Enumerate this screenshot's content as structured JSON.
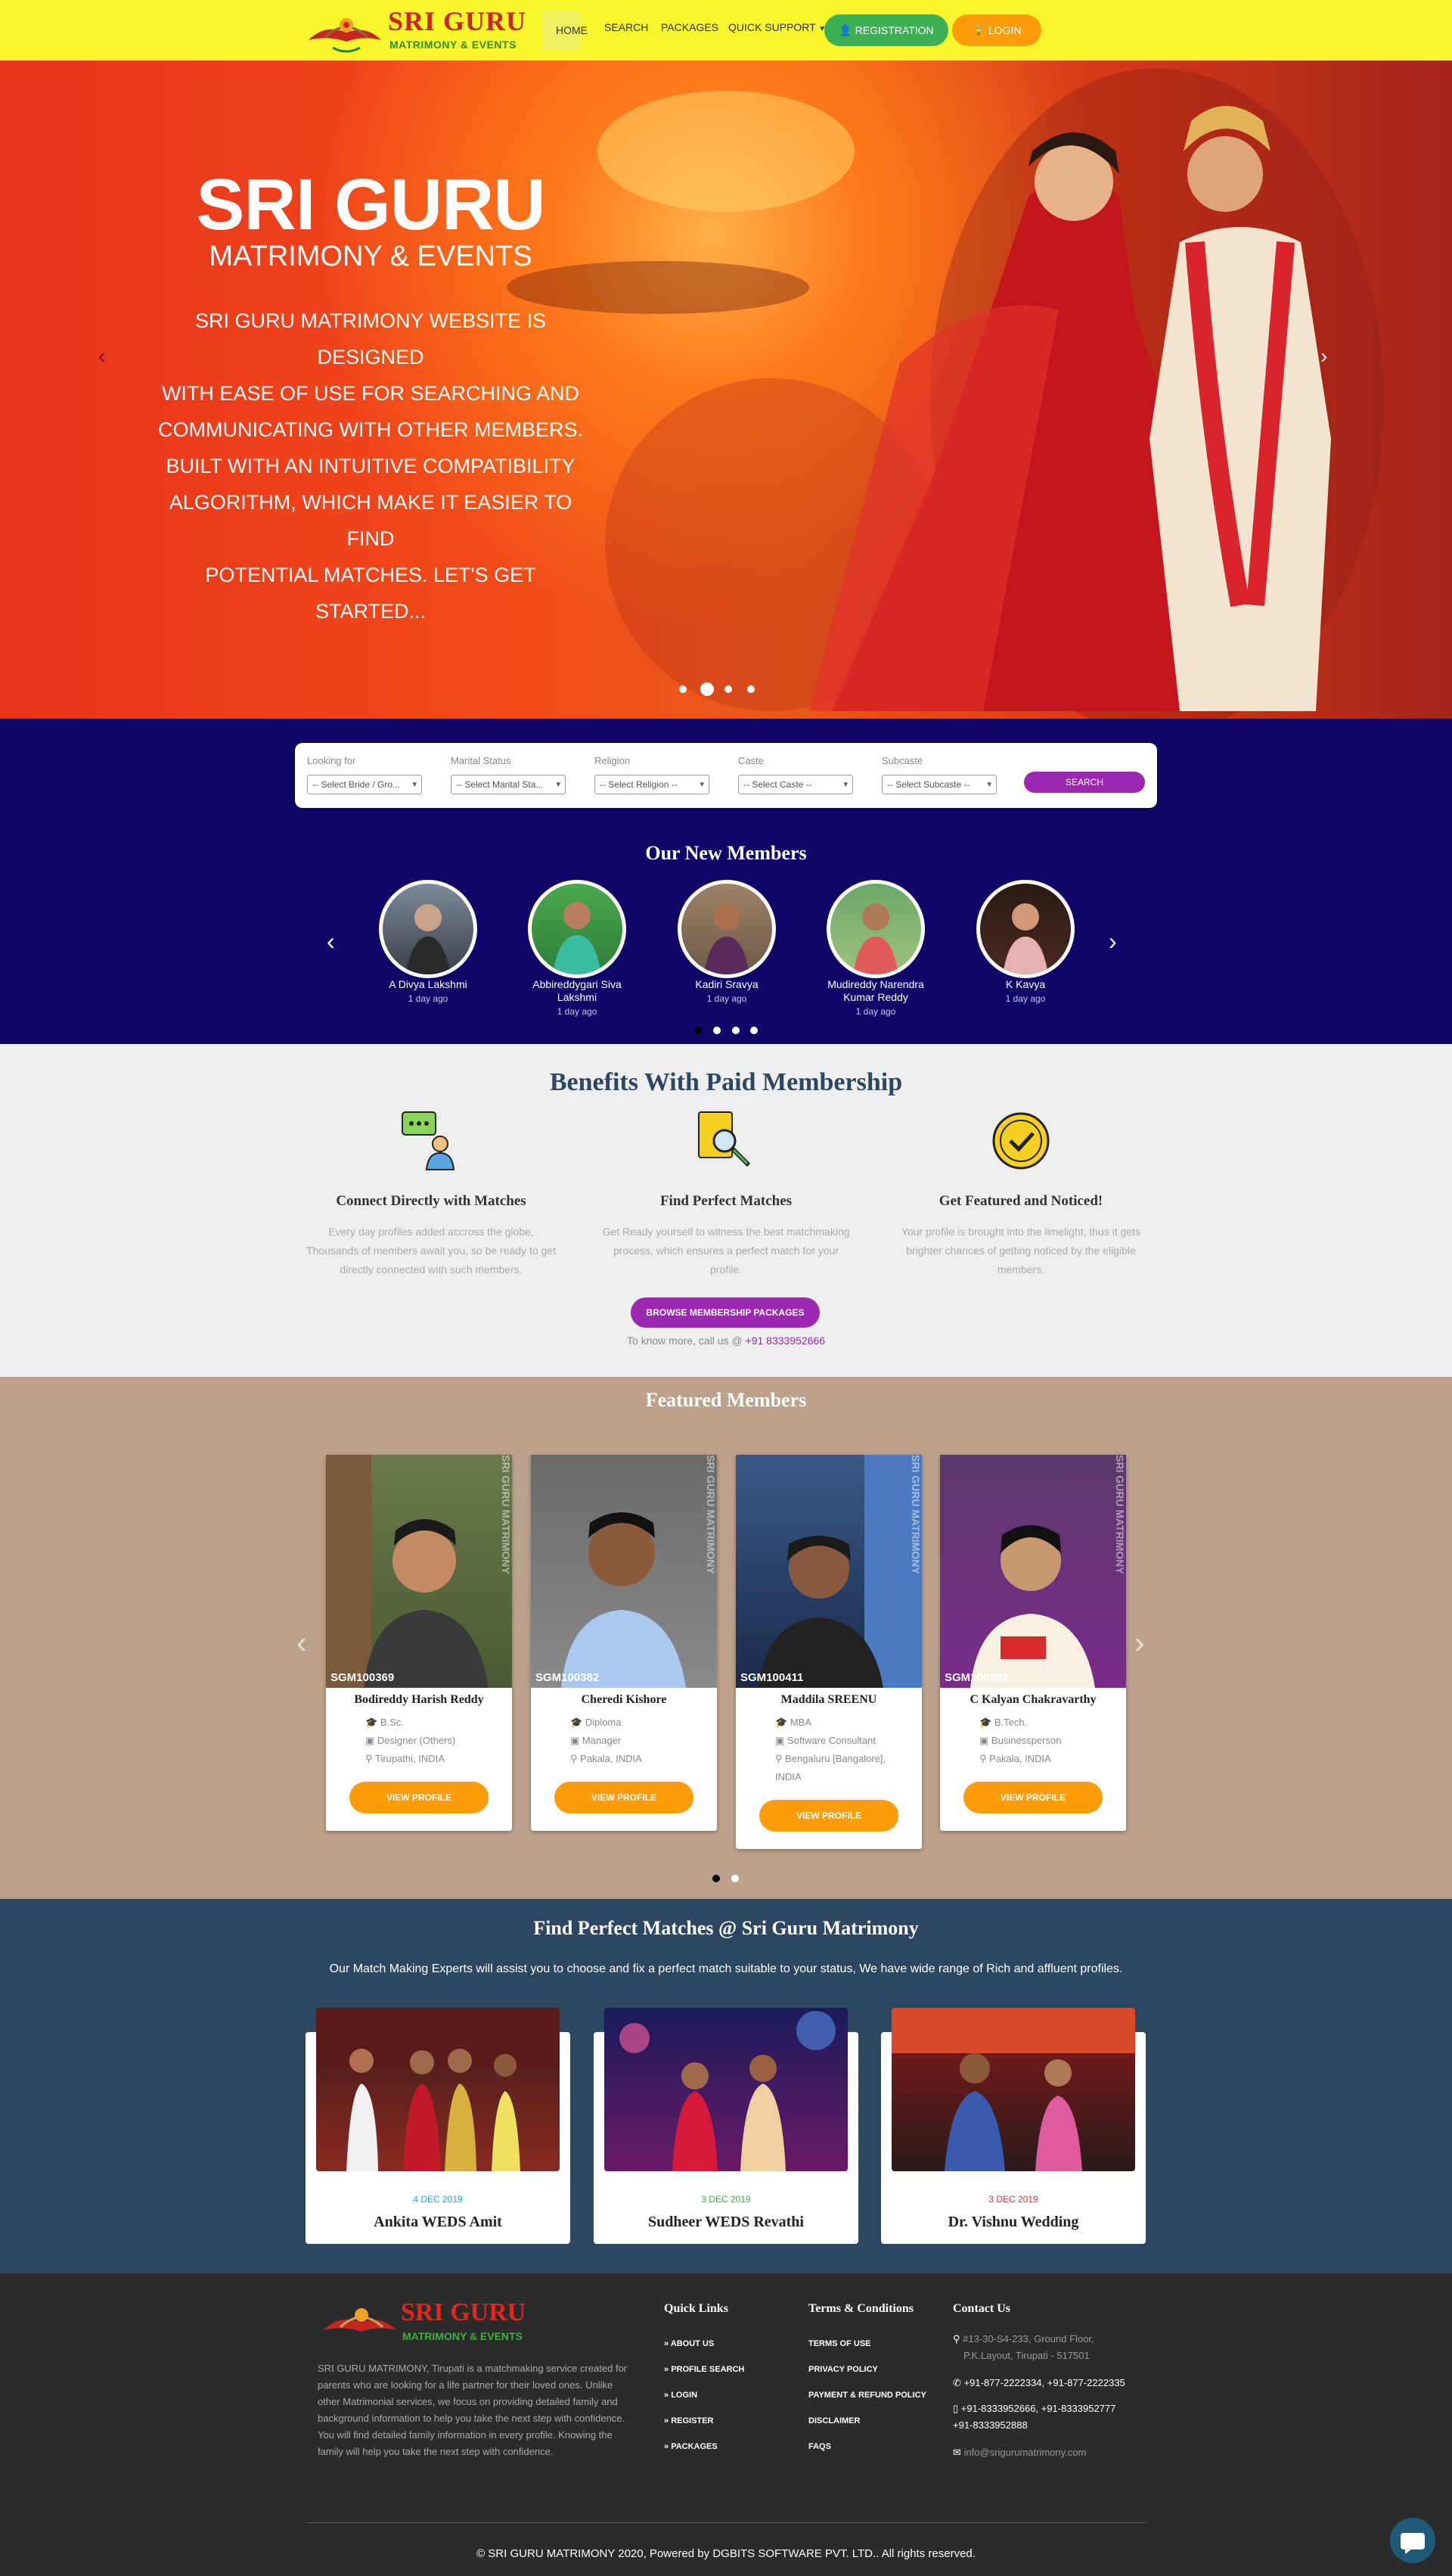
{
  "header": {
    "logo_main": "SRI GURU",
    "logo_sub": "MATRIMONY & EVENTS",
    "nav": [
      "HOME",
      "SEARCH",
      "PACKAGES",
      "QUICK SUPPORT"
    ],
    "registration": "REGISTRATION",
    "login": "LOGIN"
  },
  "hero": {
    "title": "SRI GURU",
    "subtitle": "MATRIMONY & EVENTS",
    "lines": [
      "SRI GURU MATRIMONY WEBSITE IS DESIGNED",
      "WITH EASE OF USE FOR SEARCHING AND",
      "COMMUNICATING WITH OTHER MEMBERS.",
      "BUILT WITH AN INTUITIVE COMPATIBILITY",
      "ALGORITHM, WHICH MAKE IT EASIER TO FIND",
      "POTENTIAL MATCHES.  LET'S GET STARTED..."
    ]
  },
  "search": {
    "fields": [
      {
        "label": "Looking for",
        "value": "-- Select Bride / Gro..."
      },
      {
        "label": "Marital Status",
        "value": "-- Select Marital Sta..."
      },
      {
        "label": "Religion",
        "value": "-- Select Religion --"
      },
      {
        "label": "Caste",
        "value": "-- Select Caste --"
      },
      {
        "label": "Subcaste",
        "value": "-- Select Subcaste --"
      }
    ],
    "button": "SEARCH"
  },
  "new_members": {
    "title": "Our New Members",
    "members": [
      {
        "name": "A Divya Lakshmi",
        "time": "1 day ago"
      },
      {
        "name": "Abbireddygari Siva Lakshmi",
        "time": "1 day ago"
      },
      {
        "name": "Kadiri Sravya",
        "time": "1 day ago"
      },
      {
        "name": "Mudireddy Narendra Kumar Reddy",
        "time": "1 day ago"
      },
      {
        "name": "K Kavya",
        "time": "1 day ago"
      }
    ]
  },
  "benefits": {
    "title": "Benefits With Paid Membership",
    "items": [
      {
        "title": "Connect Directly with Matches",
        "text": "Every day profiles added accross the globe, Thousands of members await you, so be ready to get directly connected with such members."
      },
      {
        "title": "Find Perfect Matches",
        "text": "Get Ready yourself to witness the best matchmaking process, which ensures a perfect match for your profile."
      },
      {
        "title": "Get Featured and Noticed!",
        "text": "Your profile is brought into the limelight, thus it gets brighter chances of getting noticed by the eligible members."
      }
    ],
    "button": "BROWSE MEMBERSHIP PACKAGES",
    "call_text": "To know more, call us @",
    "phone": "+91 8333952666"
  },
  "featured": {
    "title": "Featured Members",
    "watermark": "SRI GURU MATRIMONY",
    "view": "VIEW PROFILE",
    "cards": [
      {
        "id": "SGM100369",
        "name": "Bodireddy Harish Reddy",
        "edu": "B.Sc.",
        "job": "Designer (Others)",
        "loc": "Tirupathi, INDIA"
      },
      {
        "id": "SGM100382",
        "name": "Cheredi Kishore",
        "edu": "Diploma",
        "job": "Manager",
        "loc": "Pakala, INDIA"
      },
      {
        "id": "SGM100411",
        "name": "Maddila SREENU",
        "edu": "MBA",
        "job": "Software Consultant",
        "loc": "Bengaluru [Bangalore], INDIA"
      },
      {
        "id": "SGM100392",
        "name": "C Kalyan Chakravarthy",
        "edu": "B.Tech.",
        "job": "Businessperson",
        "loc": "Pakala, INDIA"
      }
    ]
  },
  "weddings": {
    "title": "Find Perfect Matches @ Sri Guru Matrimony",
    "subtitle": "Our Match Making Experts will assist you to choose and fix a perfect match suitable to your status, We have wide range of Rich and affluent profiles.",
    "items": [
      {
        "date": "4 DEC 2019",
        "title": "Ankita WEDS Amit",
        "color": "#2a9fd8"
      },
      {
        "date": "3 DEC 2019",
        "title": "Sudheer WEDS Revathi",
        "color": "#3aa64a"
      },
      {
        "date": "3 DEC 2019",
        "title": "Dr. Vishnu Wedding",
        "color": "#e03030"
      }
    ]
  },
  "footer": {
    "about": "SRI GURU MATRIMONY, Tirupati is a matchmaking service created for parents who are looking for a life partner for their loved ones. Unlike other Matrimonial services, we focus on providing detailed family and background information to help you take the next step with confidence. You will find detailed family information in every profile. Knowing the family will help you take the next step with confidence.",
    "quick_title": "Quick Links",
    "quick": [
      "ABOUT US",
      "PROFILE SEARCH",
      "LOGIN",
      "REGISTER",
      "PACKAGES"
    ],
    "terms_title": "Terms & Conditions",
    "terms": [
      "TERMS OF USE",
      "PRIVACY POLICY",
      "PAYMENT & REFUND POLICY",
      "DISCLAIMER",
      "FAQS"
    ],
    "contact_title": "Contact Us",
    "address1": "#13-30-S4-233, Ground Floor,",
    "address2": "P.K.Layout, Tirupati - 517501",
    "phones1": "+91-877-2222334, +91-877-2222335",
    "phones2": "+91-8333952666, +91-8333952777",
    "phones3": "+91-8333952888",
    "email": "info@srigurumatrimony.com",
    "copyright_pre": "© SRI GURU MATRIMONY 2020, Powered by",
    "company": "DGBITS SOFTWARE PVT. LTD.",
    "copyright_post": "All rights reserved."
  }
}
